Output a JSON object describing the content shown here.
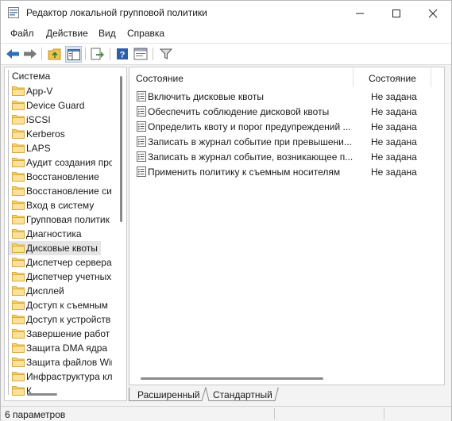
{
  "window": {
    "title": "Редактор локальной групповой политики"
  },
  "menu": [
    "Файл",
    "Действие",
    "Вид",
    "Справка"
  ],
  "toolbar": {
    "icons": [
      "back-arrow",
      "forward-arrow",
      "up-folder",
      "show-hide-tree",
      "export-list",
      "help",
      "properties",
      "filter"
    ]
  },
  "tree": {
    "root_label": "Система",
    "items": [
      {
        "label": "App-V"
      },
      {
        "label": "Device Guard"
      },
      {
        "label": "iSCSI"
      },
      {
        "label": "Kerberos"
      },
      {
        "label": "LAPS"
      },
      {
        "label": "Аудит создания про"
      },
      {
        "label": "Восстановление"
      },
      {
        "label": "Восстановление си"
      },
      {
        "label": "Вход в систему"
      },
      {
        "label": "Групповая политик"
      },
      {
        "label": "Диагностика"
      },
      {
        "label": "Дисковые квоты",
        "selected": true
      },
      {
        "label": "Диспетчер сервера"
      },
      {
        "label": "Диспетчер учетных"
      },
      {
        "label": "Дисплей"
      },
      {
        "label": "Доступ к съемным"
      },
      {
        "label": "Доступ к устройств"
      },
      {
        "label": "Завершение работ"
      },
      {
        "label": "Защита DMA ядра"
      },
      {
        "label": "Защита файлов Wir"
      },
      {
        "label": "Инфраструктура кл"
      },
      {
        "label": "К"
      }
    ]
  },
  "list": {
    "columns": [
      "Состояние",
      "Состояние"
    ],
    "rows": [
      {
        "name": "Включить дисковые квоты",
        "state": "Не задана"
      },
      {
        "name": "Обеспечить соблюдение дисковой квоты",
        "state": "Не задана"
      },
      {
        "name": "Определить квоту и порог предупреждений ...",
        "state": "Не задана"
      },
      {
        "name": "Записать в журнал событие при превышени...",
        "state": "Не задана"
      },
      {
        "name": "Записать в журнал событие, возникающее п...",
        "state": "Не задана"
      },
      {
        "name": "Применить политику к съемным носителям",
        "state": "Не задана"
      }
    ]
  },
  "tabs": [
    "Расширенный",
    "Стандартный"
  ],
  "status": {
    "text": "6 параметров"
  },
  "colors": {
    "folder_fill": "#f7d46b",
    "folder_edge": "#d9a93a",
    "selection": "#e5e5e5",
    "nav_arrow": "#2f6fb4"
  }
}
